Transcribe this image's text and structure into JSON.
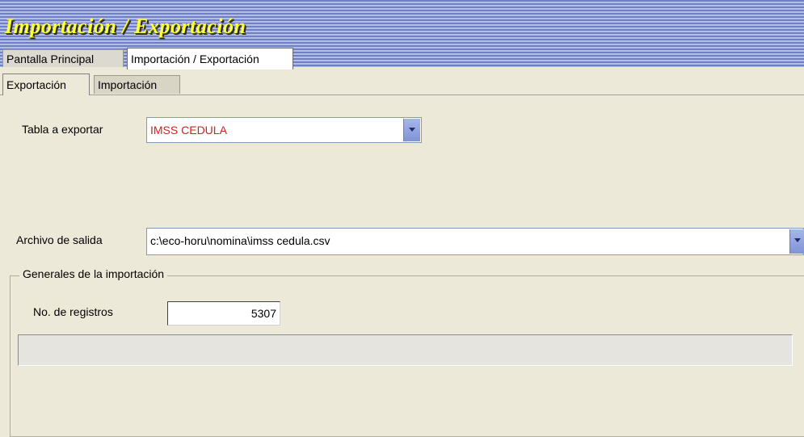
{
  "window": {
    "title": "Importación / Exportación"
  },
  "tabs": [
    {
      "label": "Pantalla Principal",
      "active": false
    },
    {
      "label": "Importación / Exportación",
      "active": true
    }
  ],
  "subtabs": [
    {
      "label": "Exportación",
      "active": true
    },
    {
      "label": "Importación",
      "active": false
    }
  ],
  "export": {
    "table_label": "Tabla a exportar",
    "table_value": "IMSS CEDULA",
    "table_value_color": "#d42020",
    "output_label": "Archivo de salida",
    "output_value": "c:\\eco-horu\\nomina\\imss cedula.csv"
  },
  "group": {
    "legend": "Generales de la importación",
    "records_label": "No. de registros",
    "records_value": "5307",
    "progress_fraction": 0
  },
  "icons": {
    "dropdown": "chevron-down-icon"
  },
  "colors": {
    "title_text": "#ffff33",
    "dropdown_accent": "#7f93d6"
  }
}
